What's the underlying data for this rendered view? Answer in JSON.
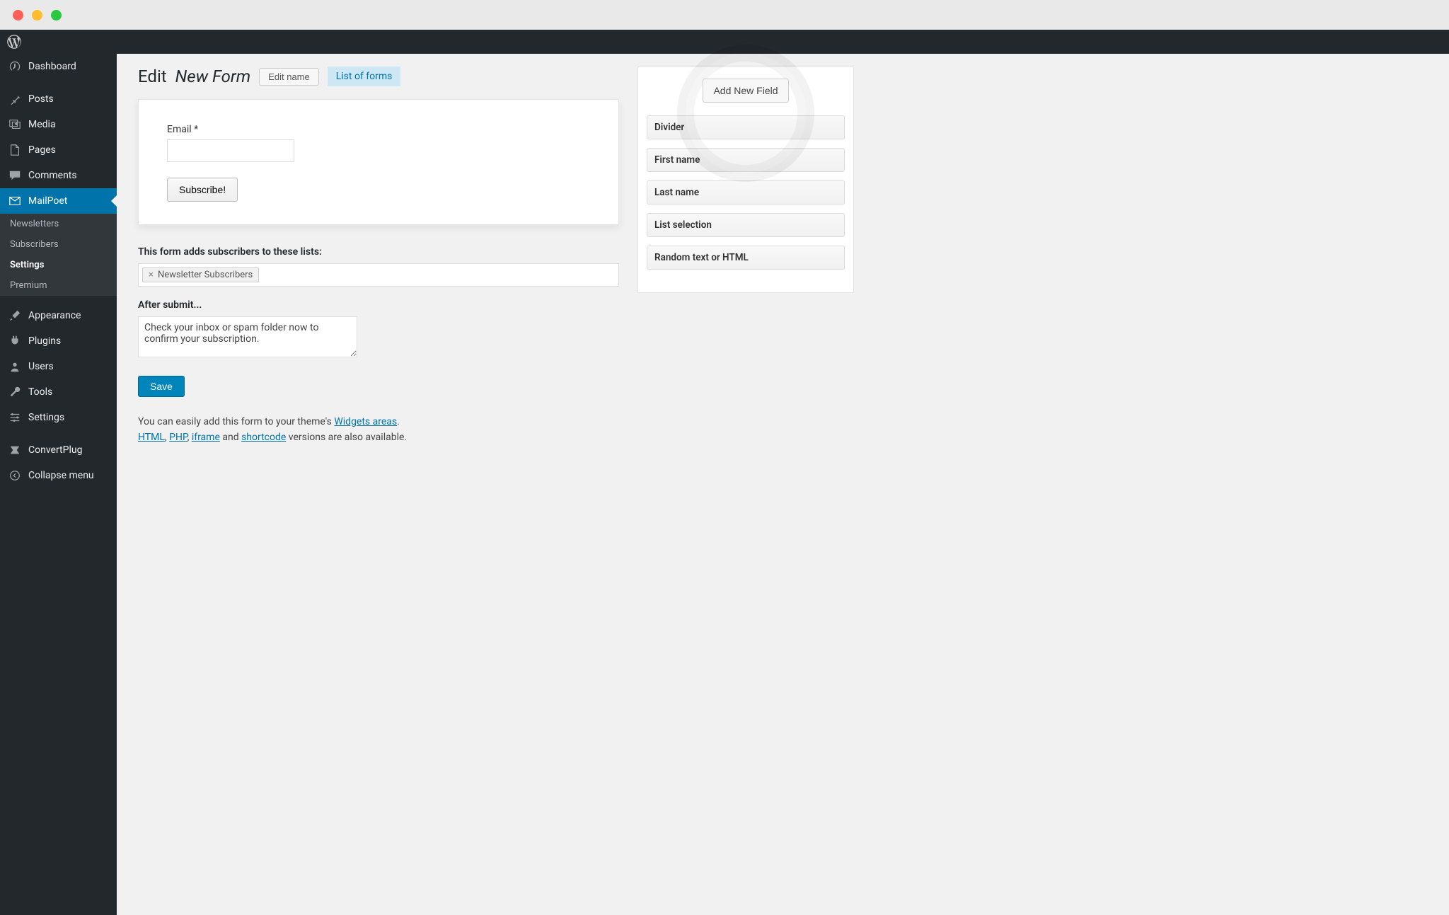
{
  "sidebar": {
    "items": [
      {
        "label": "Dashboard",
        "icon": "dashboard"
      },
      {
        "label": "Posts",
        "icon": "pin"
      },
      {
        "label": "Media",
        "icon": "media"
      },
      {
        "label": "Pages",
        "icon": "pages"
      },
      {
        "label": "Comments",
        "icon": "comments"
      },
      {
        "label": "MailPoet",
        "icon": "mail",
        "current": true
      },
      {
        "label": "Appearance",
        "icon": "brush"
      },
      {
        "label": "Plugins",
        "icon": "plug"
      },
      {
        "label": "Users",
        "icon": "user"
      },
      {
        "label": "Tools",
        "icon": "wrench"
      },
      {
        "label": "Settings",
        "icon": "sliders"
      },
      {
        "label": "ConvertPlug",
        "icon": "convert"
      },
      {
        "label": "Collapse menu",
        "icon": "collapse"
      }
    ],
    "submenu": [
      "Newsletters",
      "Subscribers",
      "Settings",
      "Premium"
    ],
    "submenu_active": "Settings"
  },
  "page": {
    "title_prefix": "Edit",
    "title_em": "New Form",
    "edit_name_label": "Edit name",
    "list_of_forms_label": "List of forms"
  },
  "preview": {
    "email_label": "Email *",
    "subscribe_label": "Subscribe!"
  },
  "lists": {
    "heading": "This form adds subscribers to these lists:",
    "token": "Newsletter Subscribers"
  },
  "after_submit": {
    "heading": "After submit...",
    "text": "Check your inbox or spam folder now to confirm your subscription."
  },
  "save_label": "Save",
  "help": {
    "line1_pre": "You can easily add this form to your theme's ",
    "line1_link": "Widgets areas",
    "line1_post": ".",
    "l2_html": "HTML",
    "l2_php": "PHP",
    "l2_iframe": "iframe",
    "l2_and": " and ",
    "l2_shortcode": "shortcode",
    "l2_tail": " versions are also available."
  },
  "sidebox": {
    "add_label": "Add New Field",
    "fields": [
      "Divider",
      "First name",
      "Last name",
      "List selection",
      "Random text or HTML"
    ]
  }
}
